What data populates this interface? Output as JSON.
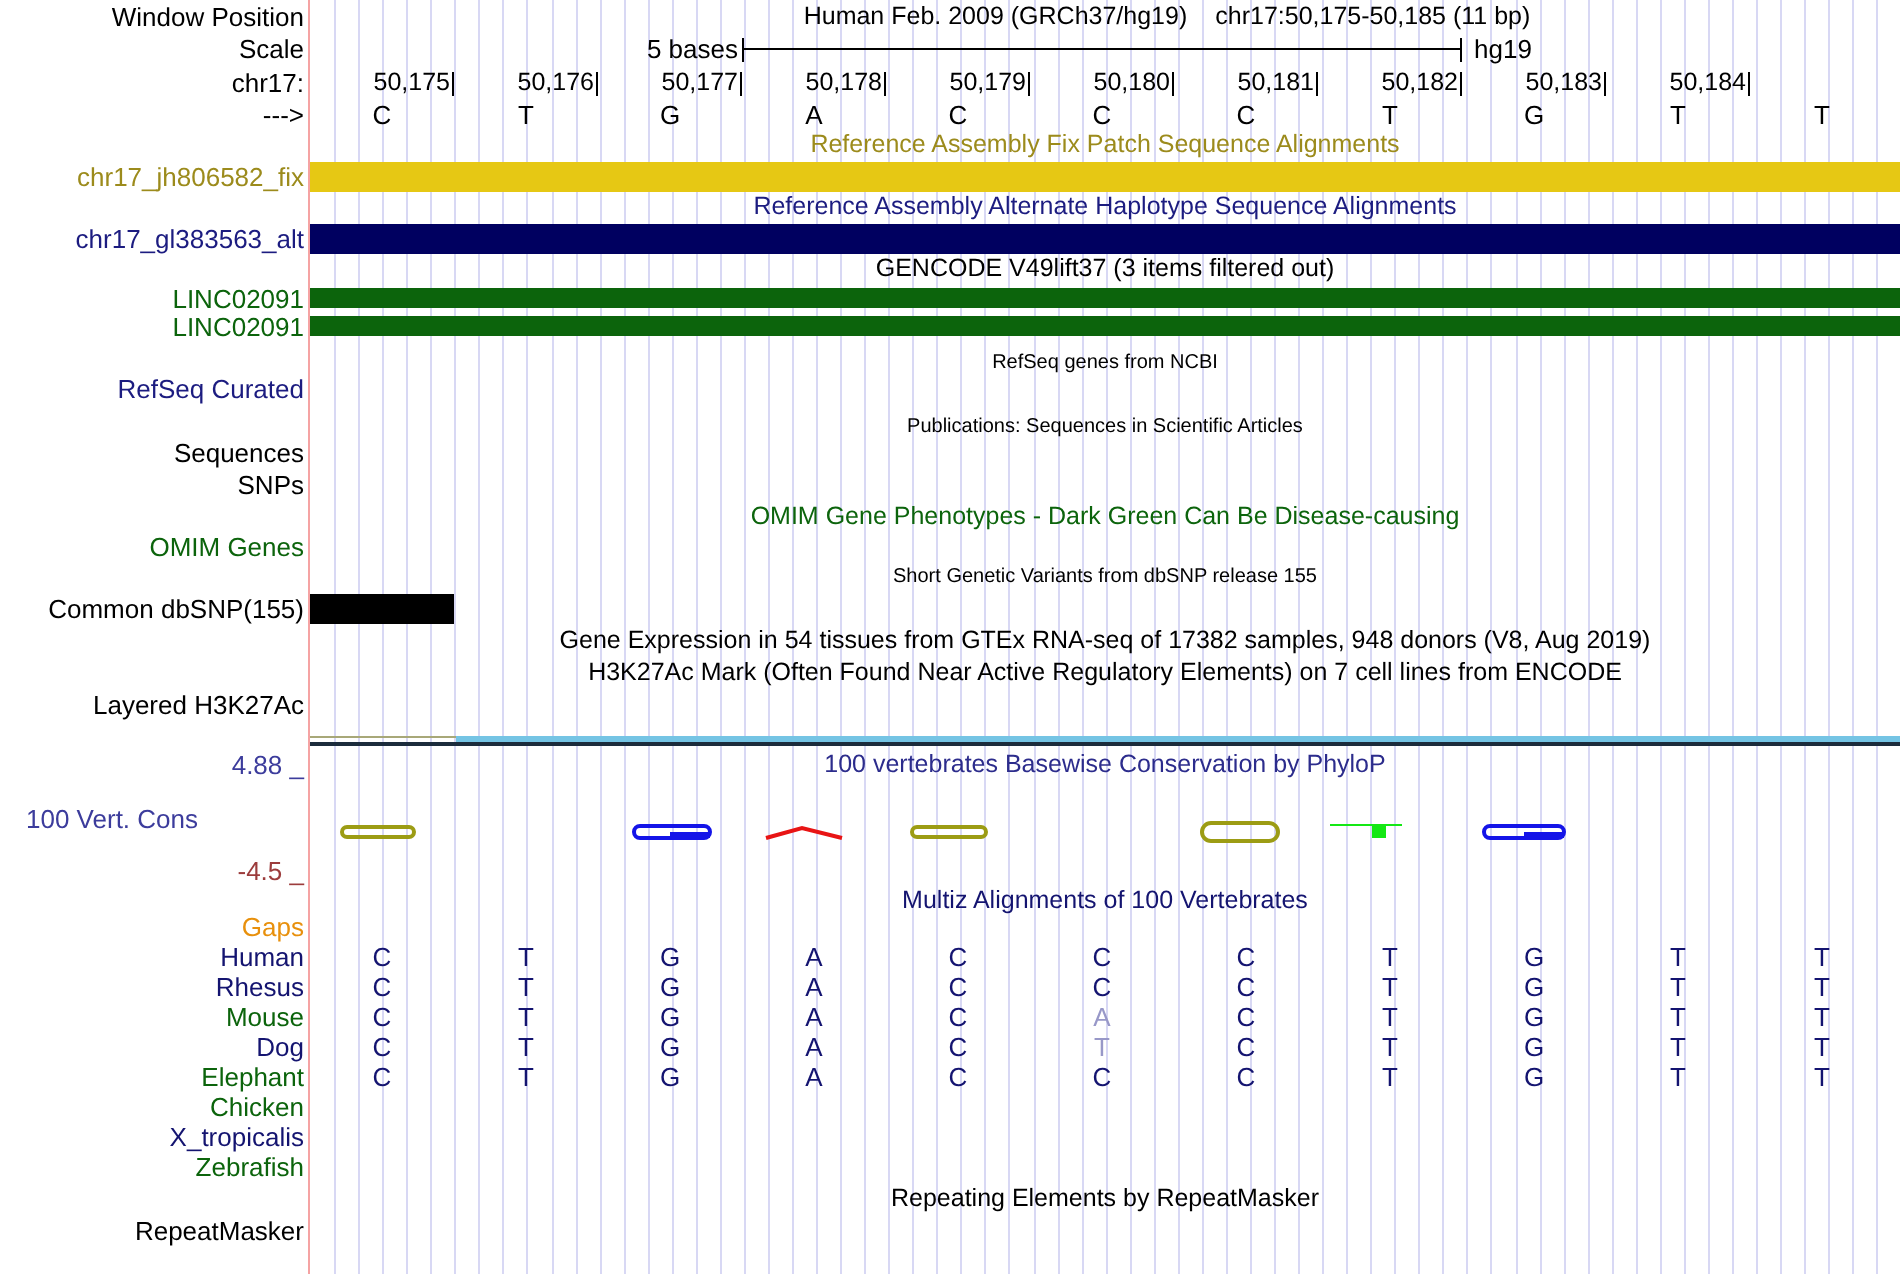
{
  "header": {
    "window_position_label": "Window Position",
    "title": "Human Feb. 2009 (GRCh37/hg19)",
    "position": "chr17:50,175-50,185 (11 bp)",
    "scale_label": "Scale",
    "scale_text": "5 bases",
    "assembly": "hg19",
    "chrom_label": "chr17:",
    "strand_label": "--->",
    "ticks": [
      "50,175",
      "50,176",
      "50,177",
      "50,178",
      "50,179",
      "50,180",
      "50,181",
      "50,182",
      "50,183",
      "50,184"
    ],
    "bases": [
      "C",
      "T",
      "G",
      "A",
      "C",
      "C",
      "C",
      "T",
      "G",
      "T",
      "T"
    ]
  },
  "tracks": [
    {
      "kind": "fix_patch",
      "title": "Reference Assembly Fix Patch Sequence Alignments",
      "label": "chr17_jh806582_fix",
      "color": "#e6c814"
    },
    {
      "kind": "alt_haplotype",
      "title": "Reference Assembly Alternate Haplotype Sequence Alignments",
      "label": "chr17_gl383563_alt",
      "color": "#000060"
    },
    {
      "kind": "genes",
      "title": "GENCODE V49lift37 (3 items filtered out)",
      "color": "#0c640c",
      "items": [
        {
          "label": "LINC02091"
        },
        {
          "label": "LINC02091"
        }
      ]
    },
    {
      "kind": "compact_list",
      "title": "RefSeq genes from NCBI",
      "labels": [
        "RefSeq Curated"
      ],
      "color": "#1c1c80"
    },
    {
      "kind": "compact_list",
      "title": "Publications: Sequences in Scientific Articles",
      "labels": [
        "Sequences",
        "SNPs"
      ],
      "color": "#000000"
    },
    {
      "kind": "label_list",
      "title": "OMIM Gene Phenotypes - Dark Green Can Be Disease-causing",
      "labels": [
        "OMIM Genes"
      ],
      "color": "#0c640c"
    },
    {
      "kind": "variants",
      "title": "Short Genetic Variants from dbSNP release 155",
      "label": "Common dbSNP(155)",
      "color": "#000000"
    },
    {
      "kind": "title_only",
      "title": "Gene Expression in 54 tissues from GTEx RNA-seq of 17382 samples, 948 donors (V8, Aug 2019)"
    },
    {
      "kind": "signal",
      "title": "H3K27Ac Mark (Often Found Near Active Regulatory Elements) on 7 cell lines from ENCODE",
      "label": "Layered H3K27Ac"
    },
    {
      "kind": "phylop",
      "title": "100 vertebrates Basewise Conservation by PhyloP",
      "label": "100 Vert. Cons",
      "max_label": "4.88 _",
      "min_label": "-4.5 _"
    },
    {
      "kind": "multiz",
      "title": "Multiz Alignments of 100 Vertebrates",
      "gaps_label": "Gaps",
      "species": [
        {
          "name": "Human",
          "color": "#141470",
          "bases": [
            {
              "base": "C",
              "differs": false
            },
            {
              "base": "T",
              "differs": false
            },
            {
              "base": "G",
              "differs": false
            },
            {
              "base": "A",
              "differs": false
            },
            {
              "base": "C",
              "differs": false
            },
            {
              "base": "C",
              "differs": false
            },
            {
              "base": "C",
              "differs": false
            },
            {
              "base": "T",
              "differs": false
            },
            {
              "base": "G",
              "differs": false
            },
            {
              "base": "T",
              "differs": false
            },
            {
              "base": "T",
              "differs": false
            }
          ]
        },
        {
          "name": "Rhesus",
          "color": "#141470",
          "bases": [
            {
              "base": "C",
              "differs": false
            },
            {
              "base": "T",
              "differs": false
            },
            {
              "base": "G",
              "differs": false
            },
            {
              "base": "A",
              "differs": false
            },
            {
              "base": "C",
              "differs": false
            },
            {
              "base": "C",
              "differs": false
            },
            {
              "base": "C",
              "differs": false
            },
            {
              "base": "T",
              "differs": false
            },
            {
              "base": "G",
              "differs": false
            },
            {
              "base": "T",
              "differs": false
            },
            {
              "base": "T",
              "differs": false
            }
          ]
        },
        {
          "name": "Mouse",
          "color": "#0c640c",
          "bases": [
            {
              "base": "C",
              "differs": false
            },
            {
              "base": "T",
              "differs": false
            },
            {
              "base": "G",
              "differs": false
            },
            {
              "base": "A",
              "differs": false
            },
            {
              "base": "C",
              "differs": false
            },
            {
              "base": "A",
              "differs": true
            },
            {
              "base": "C",
              "differs": false
            },
            {
              "base": "T",
              "differs": false
            },
            {
              "base": "G",
              "differs": false
            },
            {
              "base": "T",
              "differs": false
            },
            {
              "base": "T",
              "differs": false
            }
          ]
        },
        {
          "name": "Dog",
          "color": "#141470",
          "bases": [
            {
              "base": "C",
              "differs": false
            },
            {
              "base": "T",
              "differs": false
            },
            {
              "base": "G",
              "differs": false
            },
            {
              "base": "A",
              "differs": false
            },
            {
              "base": "C",
              "differs": false
            },
            {
              "base": "T",
              "differs": true
            },
            {
              "base": "C",
              "differs": false
            },
            {
              "base": "T",
              "differs": false
            },
            {
              "base": "G",
              "differs": false
            },
            {
              "base": "T",
              "differs": false
            },
            {
              "base": "T",
              "differs": false
            }
          ]
        },
        {
          "name": "Elephant",
          "color": "#0c640c",
          "bases": [
            {
              "base": "C",
              "differs": false
            },
            {
              "base": "T",
              "differs": false
            },
            {
              "base": "G",
              "differs": false
            },
            {
              "base": "A",
              "differs": false
            },
            {
              "base": "C",
              "differs": false
            },
            {
              "base": "C",
              "differs": false
            },
            {
              "base": "C",
              "differs": false
            },
            {
              "base": "T",
              "differs": false
            },
            {
              "base": "G",
              "differs": false
            },
            {
              "base": "T",
              "differs": false
            },
            {
              "base": "T",
              "differs": false
            }
          ]
        },
        {
          "name": "Chicken",
          "color": "#0c640c"
        },
        {
          "name": "X_tropicalis",
          "color": "#141470"
        },
        {
          "name": "Zebrafish",
          "color": "#0c640c"
        }
      ]
    },
    {
      "kind": "repeats",
      "title": "Repeating Elements by RepeatMasker",
      "label": "RepeatMasker"
    }
  ]
}
